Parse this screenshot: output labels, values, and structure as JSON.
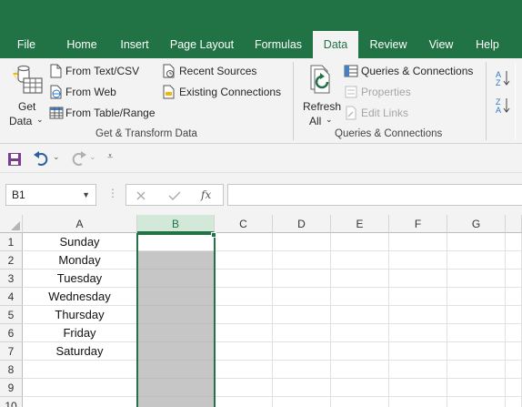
{
  "tabs": [
    "File",
    "Home",
    "Insert",
    "Page Layout",
    "Formulas",
    "Data",
    "Review",
    "View",
    "Help"
  ],
  "active_tab": "Data",
  "ribbon": {
    "get_data_line1": "Get",
    "get_data_line2": "Data",
    "from_text_csv": "From Text/CSV",
    "from_web": "From Web",
    "from_table_range": "From Table/Range",
    "recent_sources": "Recent Sources",
    "existing_connections": "Existing Connections",
    "group_get_transform": "Get & Transform Data",
    "refresh_line1": "Refresh",
    "refresh_line2": "All",
    "queries_connections": "Queries & Connections",
    "properties": "Properties",
    "edit_links": "Edit Links",
    "group_queries": "Queries & Connections"
  },
  "formula_bar": {
    "name_box": "B1",
    "fx": "fx",
    "value": ""
  },
  "columns": [
    "A",
    "B",
    "C",
    "D",
    "E",
    "F",
    "G"
  ],
  "selected_column": "B",
  "rows": [
    "1",
    "2",
    "3",
    "4",
    "5",
    "6",
    "7",
    "8",
    "9",
    "10"
  ],
  "column_a_values": [
    "Sunday",
    "Monday",
    "Tuesday",
    "Wednesday",
    "Thursday",
    "Friday",
    "Saturday",
    "",
    "",
    ""
  ],
  "accent_color": "#217346"
}
